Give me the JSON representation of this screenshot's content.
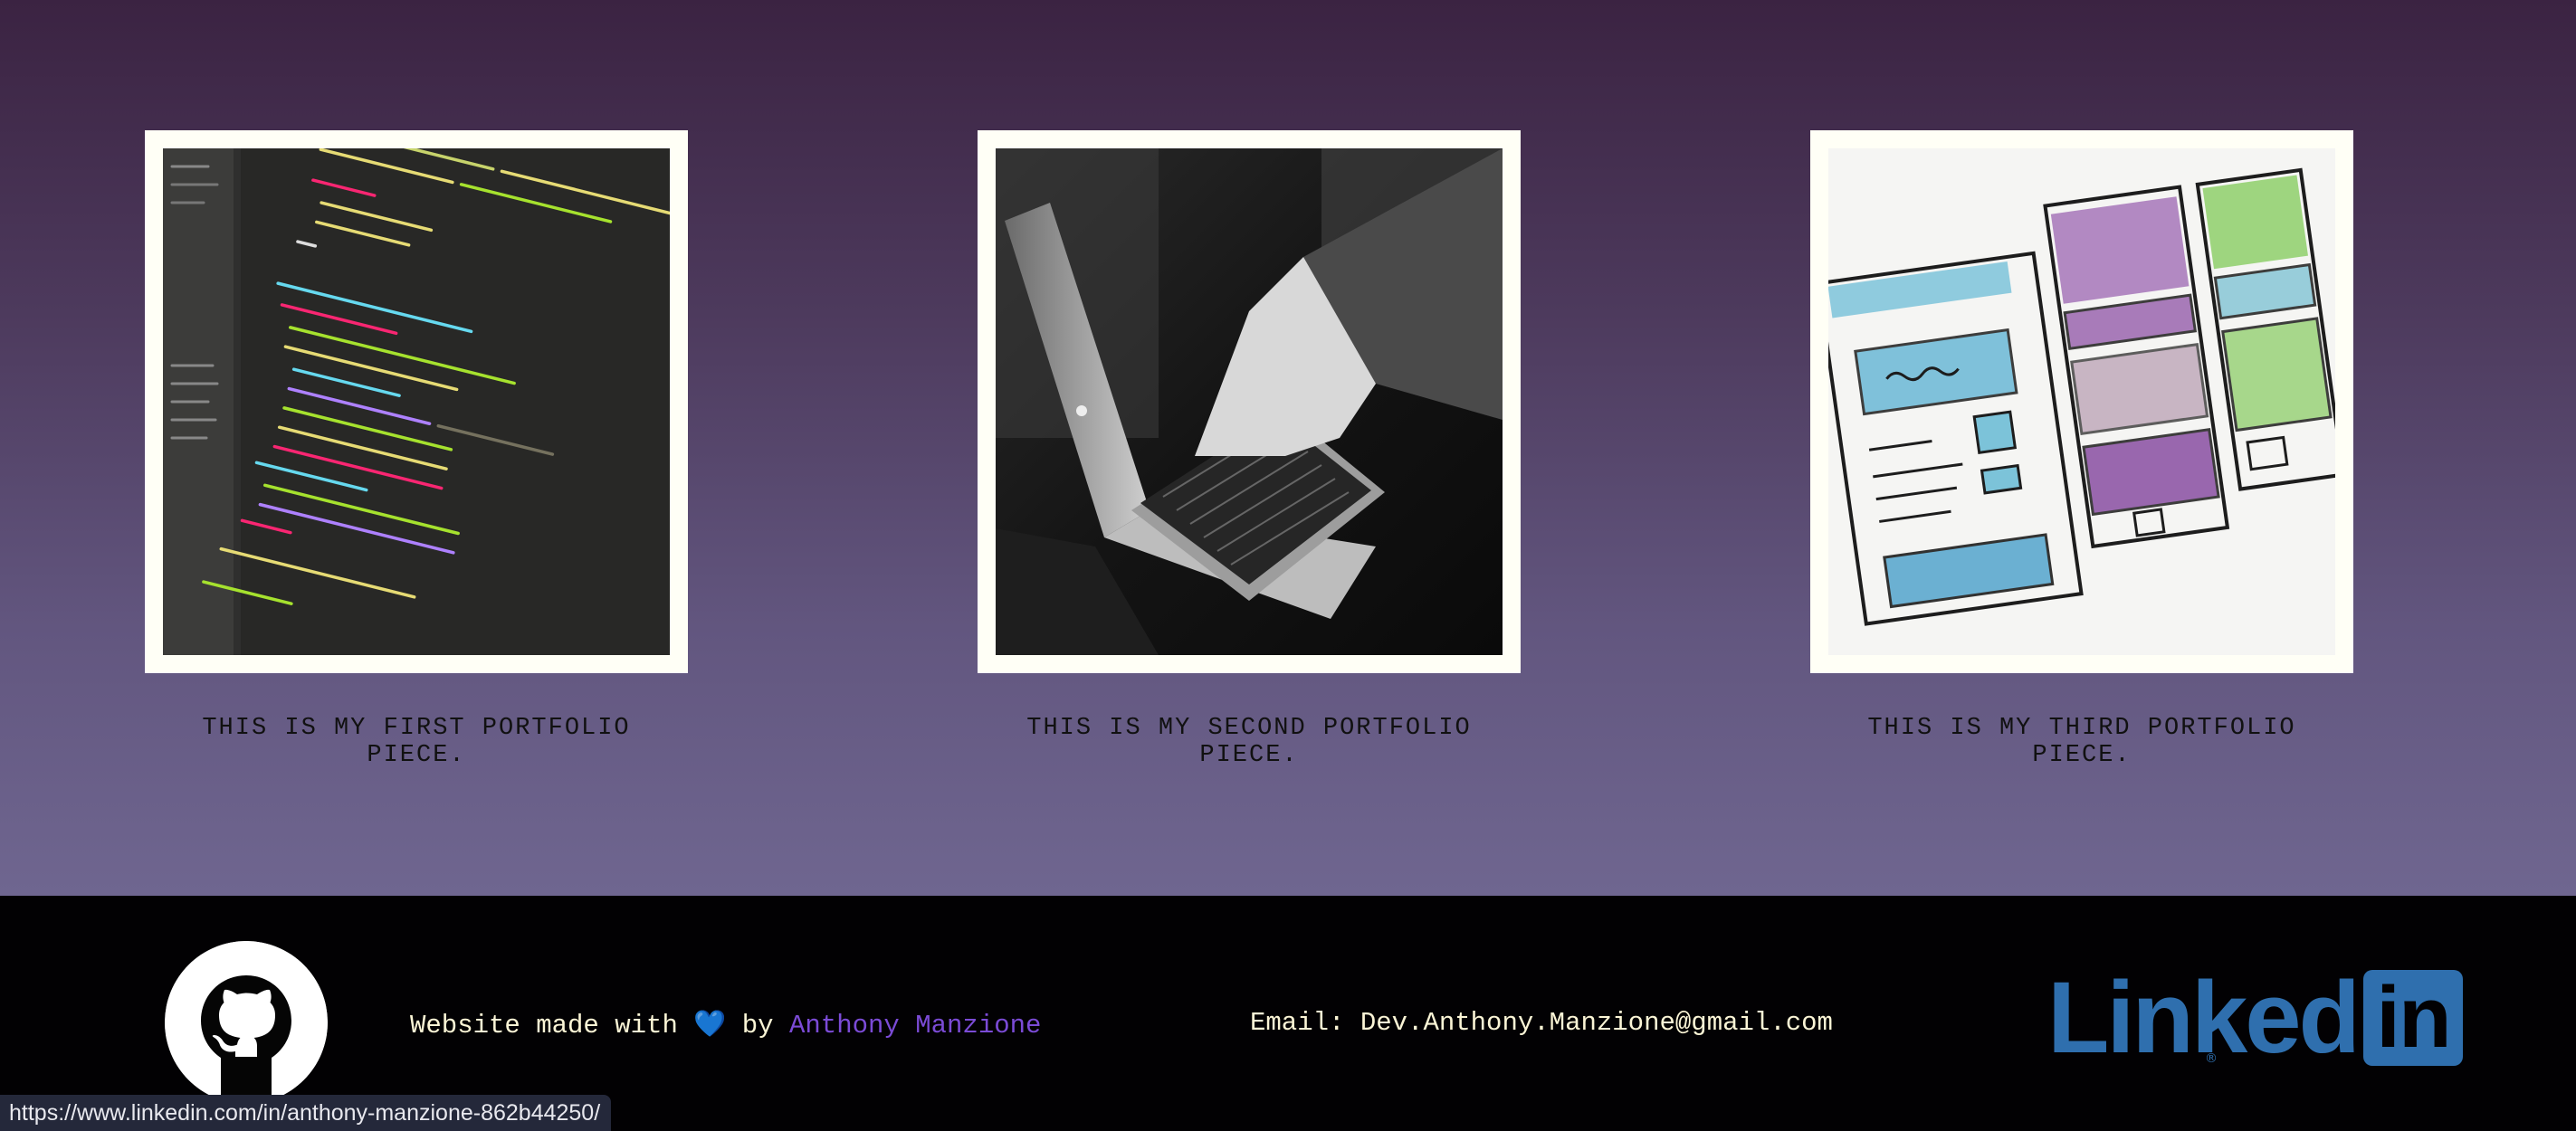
{
  "portfolio": {
    "pieces": [
      {
        "caption": "THIS IS MY FIRST PORTFOLIO PIECE.",
        "image": "code-editor-screenshot"
      },
      {
        "caption": "THIS IS MY SECOND PORTFOLIO PIECE.",
        "image": "laptop-typing-photo"
      },
      {
        "caption": "THIS IS MY THIRD PORTFOLIO PIECE.",
        "image": "wireframe-sketch-photo"
      }
    ]
  },
  "footer": {
    "github_icon": "github-icon",
    "made_with_prefix": "Website made with",
    "heart": "💙",
    "by": "by",
    "author": "Anthony Manzione",
    "email_label": "Email:",
    "email": "Dev.Anthony.Manzione@gmail.com",
    "linkedin_word": "Linked",
    "linkedin_in": "in",
    "linkedin_reg": "®"
  },
  "status_bar": {
    "url": "https://www.linkedin.com/in/anthony-manzione-862b44250/"
  },
  "colors": {
    "gradient_top": "#3b2342",
    "gradient_bottom": "#6f6690",
    "footer_bg": "#020103",
    "footer_text": "#fbf5d6",
    "author_link": "#7b4bd6",
    "linkedin_blue": "#2f6fae"
  }
}
